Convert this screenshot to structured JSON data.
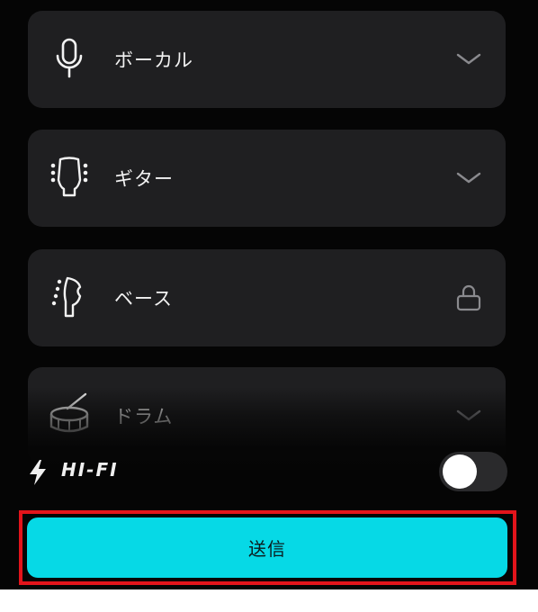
{
  "instruments": [
    {
      "label": "ボーカル",
      "icon": "microphone-icon",
      "state": "chevron-down-icon"
    },
    {
      "label": "ギター",
      "icon": "guitar-headstock-icon",
      "state": "chevron-down-icon"
    },
    {
      "label": "ベース",
      "icon": "bass-headstock-icon",
      "state": "lock-icon"
    },
    {
      "label": "ドラム",
      "icon": "drum-icon",
      "state": "chevron-down-icon"
    }
  ],
  "hifi": {
    "label": "HI-FI",
    "icon": "lightning-icon",
    "enabled": false
  },
  "submit": {
    "label": "送信"
  },
  "colors": {
    "background": "#050505",
    "card": "#1f1f21",
    "accent": "#06d9e6",
    "highlight_border": "#e3141b"
  }
}
